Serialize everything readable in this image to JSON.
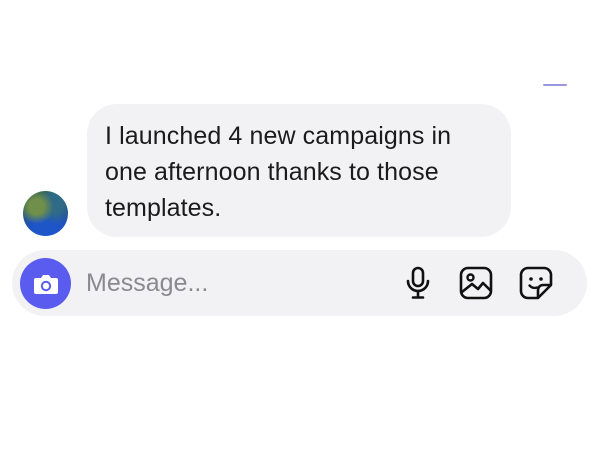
{
  "chat": {
    "message": {
      "text": "I launched 4 new campaigns in one afternoon thanks to those templates."
    }
  },
  "composer": {
    "placeholder": "Message...",
    "icons": [
      "camera-icon",
      "microphone-icon",
      "image-gallery-icon",
      "sticker-icon"
    ]
  },
  "colors": {
    "accent": "#5a5cf0",
    "bubble_bg": "#f2f2f4",
    "text": "#1b1b1d",
    "placeholder": "#8a8a8e"
  }
}
